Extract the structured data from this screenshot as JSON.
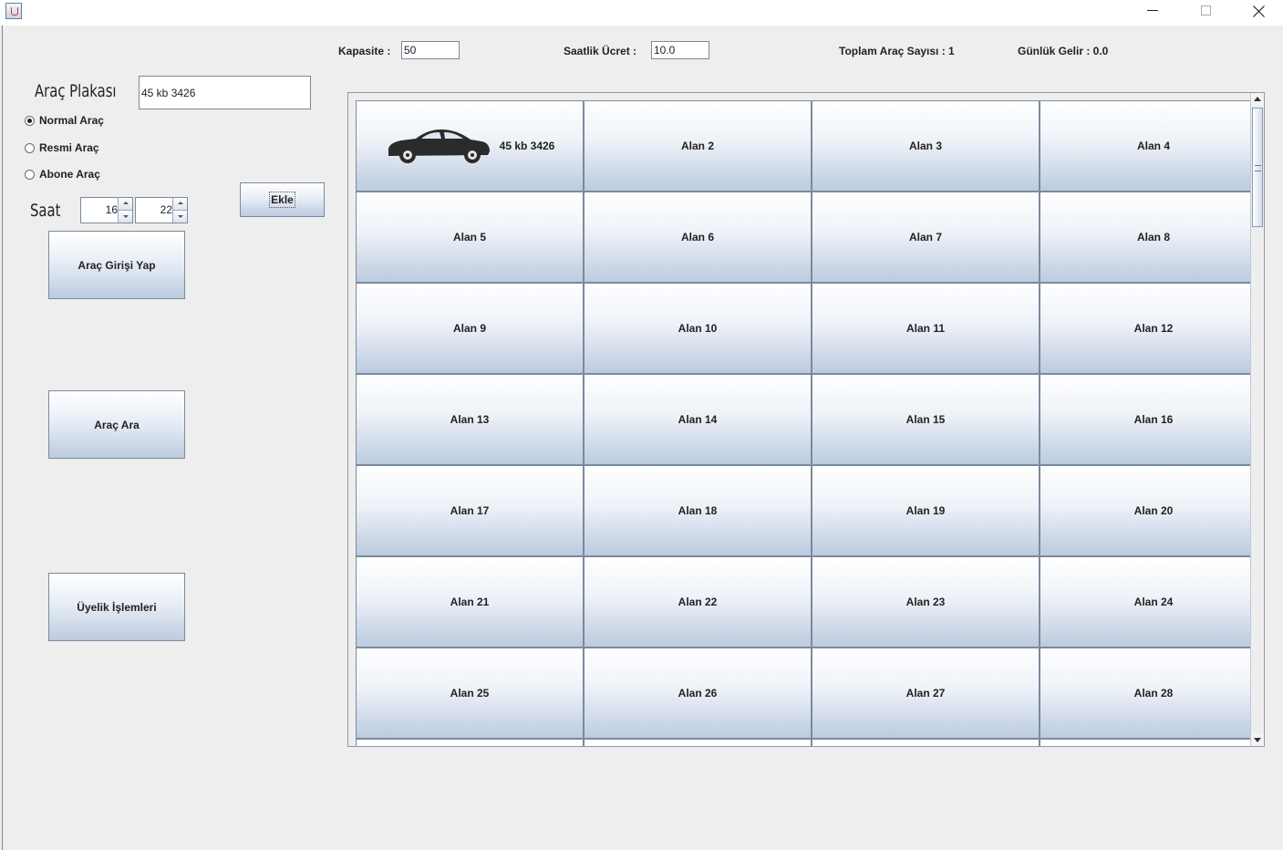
{
  "header": {
    "kapasite_label": "Kapasite :",
    "kapasite_value": "50",
    "ucret_label": "Saatlik Ücret :",
    "ucret_value": "10.0",
    "toplam_label": "Toplam Araç Sayısı : 1",
    "gelir_label": "Günlük Gelir : 0.0"
  },
  "form": {
    "plaka_label": "Araç Plakası",
    "plaka_value": "45 kb 3426",
    "radios": [
      "Normal Araç",
      "Resmi Araç",
      "Abone Araç"
    ],
    "selected_radio": "Normal Araç",
    "saat_label": "Saat",
    "hour": "16",
    "minute": "22",
    "ekle_button": "Ekle",
    "giris_button": "Araç Girişi Yap",
    "ara_button": "Araç Ara",
    "uyelik_button": "Üyelik İşlemleri"
  },
  "grid": {
    "slots": [
      {
        "label": "45 kb 3426",
        "occupied": true,
        "icon": "car-icon"
      },
      {
        "label": "Alan 2"
      },
      {
        "label": "Alan 3"
      },
      {
        "label": "Alan 4"
      },
      {
        "label": "Alan 5"
      },
      {
        "label": "Alan 6"
      },
      {
        "label": "Alan 7"
      },
      {
        "label": "Alan 8"
      },
      {
        "label": "Alan 9"
      },
      {
        "label": "Alan 10"
      },
      {
        "label": "Alan 11"
      },
      {
        "label": "Alan 12"
      },
      {
        "label": "Alan 13"
      },
      {
        "label": "Alan 14"
      },
      {
        "label": "Alan 15"
      },
      {
        "label": "Alan 16"
      },
      {
        "label": "Alan 17"
      },
      {
        "label": "Alan 18"
      },
      {
        "label": "Alan 19"
      },
      {
        "label": "Alan 20"
      },
      {
        "label": "Alan 21"
      },
      {
        "label": "Alan 22"
      },
      {
        "label": "Alan 23"
      },
      {
        "label": "Alan 24"
      },
      {
        "label": "Alan 25"
      },
      {
        "label": "Alan 26"
      },
      {
        "label": "Alan 27"
      },
      {
        "label": "Alan 28"
      },
      {
        "label": ""
      },
      {
        "label": ""
      },
      {
        "label": ""
      },
      {
        "label": ""
      }
    ]
  }
}
